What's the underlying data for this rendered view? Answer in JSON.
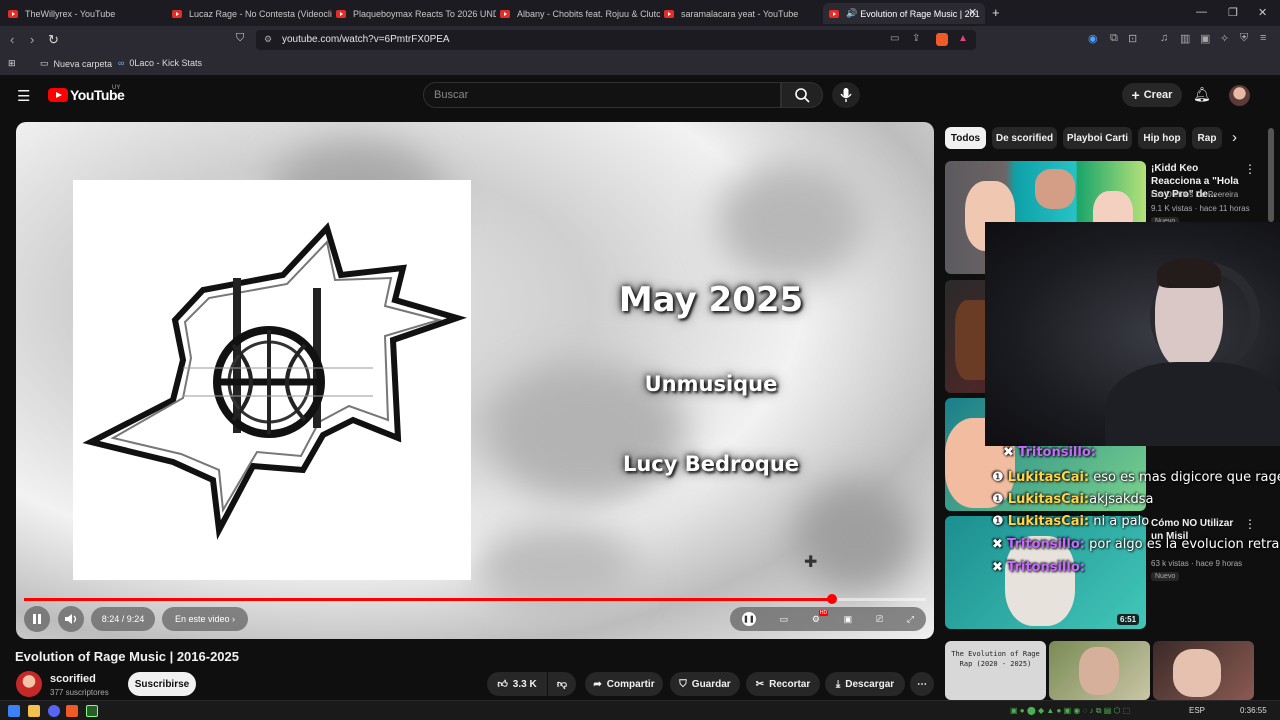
{
  "browser": {
    "tabs": [
      {
        "title": "TheWillyrex - YouTube"
      },
      {
        "title": "Lucaz Rage - No Contesta (Videoclip"
      },
      {
        "title": "Plaqueboymax Reacts To 2026 UNDE"
      },
      {
        "title": "Albany - Chobits feat. Rojuu & Clutch"
      },
      {
        "title": "saramalacara yeat - YouTube"
      },
      {
        "title": "Evolution of Rage Music | 201"
      }
    ],
    "new_tab": "+",
    "url": "youtube.com/watch?v=6PmtrFX0PEA",
    "bookmarks": [
      "Nueva carpeta",
      "0Laco - Kick Stats"
    ]
  },
  "youtube": {
    "logo": "YouTube",
    "country": "UY",
    "search_placeholder": "Buscar",
    "create_label": "Crear"
  },
  "player": {
    "overlay_lines": [
      "May 2025",
      "Unmusique",
      "Lucy Bedroque"
    ],
    "time": "8:24 / 9:24",
    "progress_fraction": 0.896,
    "chapter_label": "En este video",
    "chapter_chevron": "›",
    "hd_badge": "HD"
  },
  "video": {
    "title": "Evolution of Rage Music | 2016-2025",
    "channel": "scorified",
    "subscribers": "377 suscriptores",
    "subscribe_label": "Suscribirse",
    "likes": "3.3 K",
    "share_label": "Compartir",
    "save_label": "Guardar",
    "clip_label": "Recortar",
    "download_label": "Descargar"
  },
  "sidebar": {
    "chips": [
      "Todos",
      "De scorified",
      "Playboi Carti",
      "Hip hop",
      "Rap"
    ],
    "recs": [
      {
        "title": "¡Kidd Keo Reacciona a \"Hola Soy Pro\" de...",
        "channel": "Los Dientes De Peereira",
        "meta": "9.1 K vistas · hace 11 horas",
        "badge": "Nuevo"
      },
      {
        "title": "Cómo NO Utilizar un Misil",
        "channel": "",
        "meta": "63 k vistas · hace 9 horas",
        "badge": "Nuevo",
        "duration": "6:51"
      },
      {
        "title": "The Evolution of Rage Rap (2020 - 2025)"
      }
    ]
  },
  "chat": [
    {
      "user": "Tritonsillo:",
      "text": ""
    },
    {
      "user": "LukitasCai:",
      "text": "eso es mas digicore que rage"
    },
    {
      "user": "LukitasCai:",
      "text": "akjsakdsa"
    },
    {
      "user": "LukitasCai:",
      "text": "ni a palo"
    },
    {
      "user": "Tritonsillo:",
      "text": "por algo es la evolucion retrasao"
    },
    {
      "user": "Tritonsillo:",
      "text": ""
    }
  ],
  "taskbar": {
    "language": "ESP",
    "clock": "0:36:55"
  },
  "colors": {
    "yt_red": "#ff0000",
    "bg": "#0f0f0f",
    "chip_active": "#f1f1f1",
    "chat_user_yellow": "#ffd54a",
    "chat_user_purple": "#c66bff"
  }
}
